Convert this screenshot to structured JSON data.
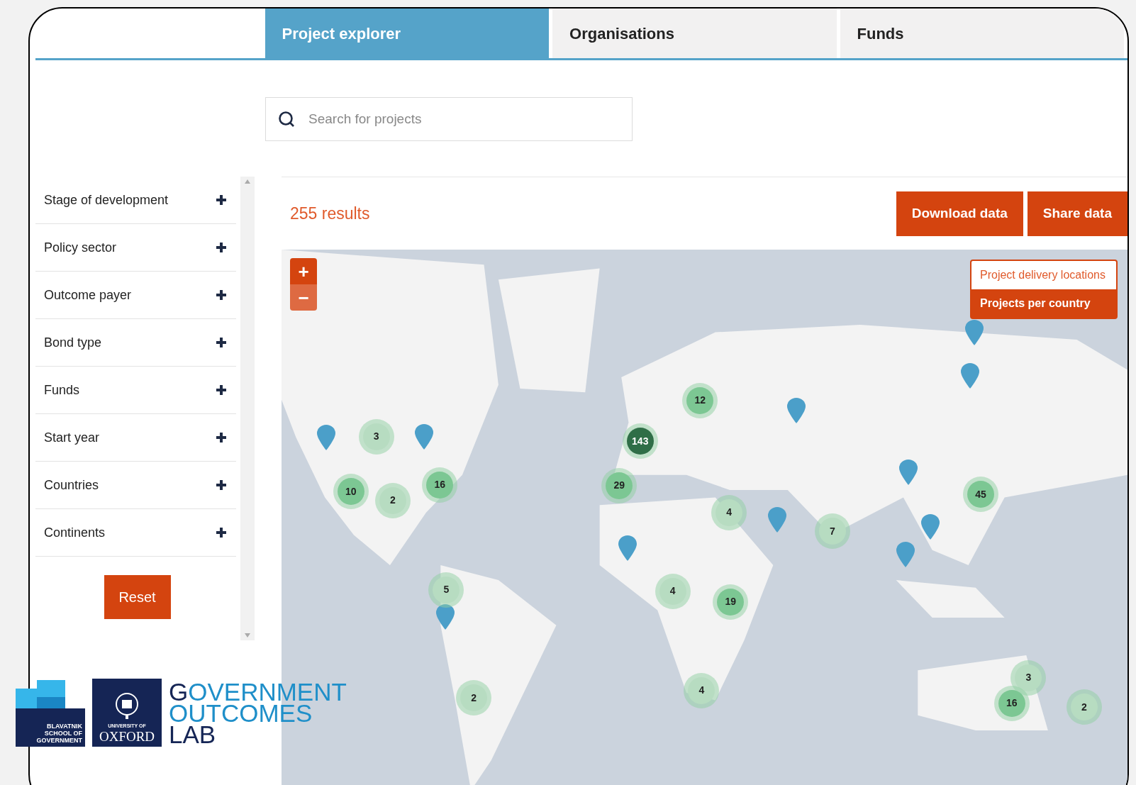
{
  "tabs": [
    {
      "label": "Project explorer",
      "selected": true
    },
    {
      "label": "Organisations",
      "selected": false
    },
    {
      "label": "Funds",
      "selected": false
    }
  ],
  "search": {
    "placeholder": "Search for projects"
  },
  "filters": [
    {
      "label": "Stage of development",
      "expanded": false
    },
    {
      "label": "Policy sector",
      "expanded": false
    },
    {
      "label": "Outcome payer",
      "expanded": false
    },
    {
      "label": "Bond type",
      "expanded": false
    },
    {
      "label": "Funds",
      "expanded": false
    },
    {
      "label": "Start year",
      "expanded": false
    },
    {
      "label": "Countries",
      "expanded": false
    },
    {
      "label": "Continents",
      "expanded": false
    }
  ],
  "reset_button": "Reset",
  "results": "255 results",
  "actions": [
    "Download data",
    "Share data"
  ],
  "map": {
    "zoom": [
      {
        "label": "+",
        "disabled": false
      },
      {
        "label": "−",
        "disabled": true
      }
    ],
    "layers": [
      {
        "label": "Project delivery locations",
        "selected": true
      },
      {
        "label": "Projects per country",
        "selected": false
      }
    ],
    "clusters": [
      {
        "count": "3",
        "color": "#b7dcc1"
      },
      {
        "count": "10",
        "color": "#7cc793"
      },
      {
        "count": "2",
        "color": "#b7dcc1"
      },
      {
        "count": "16",
        "color": "#7cc793"
      },
      {
        "count": "12",
        "color": "#7cc793"
      },
      {
        "count": "143",
        "color": "#2f6e47"
      },
      {
        "count": "29",
        "color": "#7cc793"
      },
      {
        "count": "4",
        "color": "#b7dcc1"
      },
      {
        "count": "7",
        "color": "#b7dcc1"
      },
      {
        "count": "45",
        "color": "#7cc793"
      },
      {
        "count": "5",
        "color": "#b7dcc1"
      },
      {
        "count": "4",
        "color": "#b7dcc1"
      },
      {
        "count": "19",
        "color": "#7cc793"
      },
      {
        "count": "2",
        "color": "#b7dcc1"
      },
      {
        "count": "4",
        "color": "#b7dcc1"
      },
      {
        "count": "3",
        "color": "#b7dcc1"
      },
      {
        "count": "16",
        "color": "#7cc793"
      },
      {
        "count": "2",
        "color": "#b7dcc1"
      }
    ]
  },
  "logo": {
    "school": [
      "BLAVATNIK",
      "SCHOOL OF",
      "GOVERNMENT"
    ],
    "university": "UNIVERSITY OF",
    "oxford": "OXFORD",
    "lab": [
      "GOVERNMENT",
      "OUTCOMES",
      "LAB"
    ]
  }
}
